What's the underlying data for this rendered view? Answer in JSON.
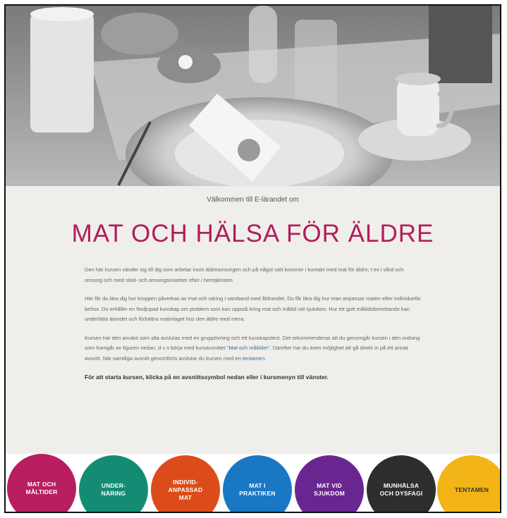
{
  "header": {
    "welcome": "Välkommen till E-lärandet om",
    "title": "MAT OCH HÄLSA FÖR ÄLDRE"
  },
  "body": {
    "p1": "Den här kursen vänder sig till dig som arbetar inom äldreomsorgen och på något sätt kommer i kontakt med mat för äldre; t ex i vård och omsorg och med stöd- och omsorgsinsatser efter i hemtjänsten.",
    "p2": "Här får du lära dig hur kroppen påverkas av mat och näring i samband med åldrandet. Du får lära dig hur man anpassar maten efter individuella behov. Du erhåller en fördjupad kunskap om problem som kan uppstå kring mat och måltid vid sjukdom. Hur ett gott måltidsbemötande kan underlätta ätandet och förbättra matintaget hos den äldre med mera.",
    "p3_a": "Kursen har den använt som alla avslutas med en gruppövning och ett kunskapstest. Det rekommenderas att du genomgår kursen i den ordning som framgår av figuren nedan, d v s börja med kursavsnittet ",
    "p3_link": "\"Mat och måltider\"",
    "p3_b": ". Därefter har du även möjlighet att gå direkt in på ett annat avsnitt. När samtliga avsnitt genomförts avslutar du kursen med en ",
    "p3_link2": "tentamen",
    "p3_c": ".",
    "cta": "För att starta kursen, klicka på en avsnittssymbol nedan eller i kursmenyn till vänster."
  },
  "nav": [
    {
      "label": "MAT OCH\nMÅLTIDER",
      "color": "#b81e60"
    },
    {
      "label": "UNDER-\nNÄRING",
      "color": "#138c73"
    },
    {
      "label": "INDIVID-\nANPASSAD\nMAT",
      "color": "#dc4c1b"
    },
    {
      "label": "MAT I\nPRAKTIKEN",
      "color": "#1a77c4"
    },
    {
      "label": "MAT VID\nSJUKDOM",
      "color": "#6a2690"
    },
    {
      "label": "MUNHÄLSA\nOCH DYSFAGI",
      "color": "#2e2e2e"
    },
    {
      "label": "TENTAMEN",
      "color": "#f2b416"
    }
  ]
}
